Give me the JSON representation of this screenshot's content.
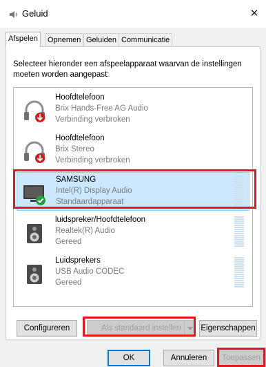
{
  "window": {
    "title": "Geluid",
    "close_glyph": "✕"
  },
  "tabs": [
    {
      "label": "Afspelen",
      "active": true
    },
    {
      "label": "Opnemen",
      "active": false
    },
    {
      "label": "Geluiden",
      "active": false
    },
    {
      "label": "Communicatie",
      "active": false
    }
  ],
  "instruction": "Selecteer hieronder een afspeelapparaat waarvan de instellingen moeten worden aangepast:",
  "devices": [
    {
      "name": "Hoofdtelefoon",
      "driver": "Brix Hands-Free AG Audio",
      "status": "Verbinding verbroken",
      "icon": "headphones-icon",
      "badge": "disconnected-badge-icon",
      "selected": false
    },
    {
      "name": "Hoofdtelefoon",
      "driver": "Brix Stereo",
      "status": "Verbinding verbroken",
      "icon": "headphones-icon",
      "badge": "disconnected-badge-icon",
      "selected": false
    },
    {
      "name": "SAMSUNG",
      "driver": "Intel(R) Display Audio",
      "status": "Standaardapparaat",
      "icon": "monitor-icon",
      "badge": "default-check-badge-icon",
      "selected": true
    },
    {
      "name": "luidspreker/Hoofdtelefoon",
      "driver": "Realtek(R) Audio",
      "status": "Gereed",
      "icon": "speaker-icon",
      "badge": "",
      "selected": false
    },
    {
      "name": "Luidsprekers",
      "driver": "USB Audio CODEC",
      "status": "Gereed",
      "icon": "speaker-icon",
      "badge": "",
      "selected": false
    }
  ],
  "buttons": {
    "configure": "Configureren",
    "set_default": "Als standaard instellen",
    "properties": "Eigenschappen",
    "ok": "OK",
    "cancel": "Annuleren",
    "apply": "Toepassen"
  },
  "colors": {
    "highlight": "#e3171d",
    "selection": "#cce8ff",
    "disconnect": "#d01f1f",
    "default_check": "#1f9e3e"
  }
}
